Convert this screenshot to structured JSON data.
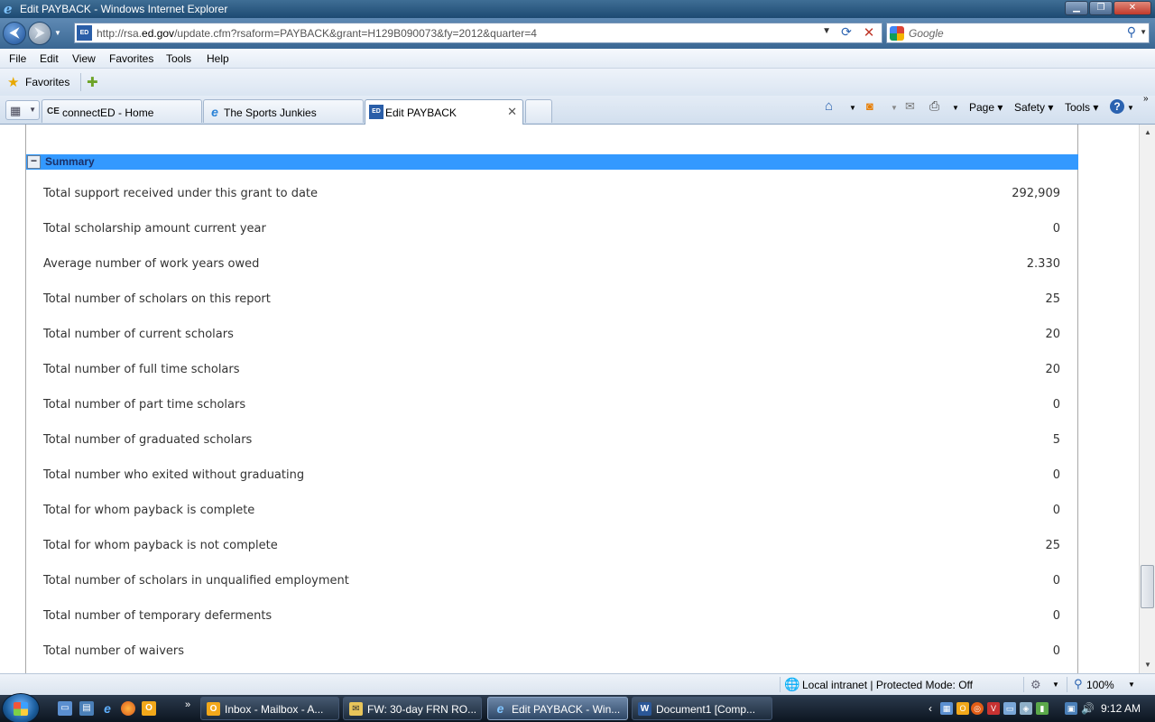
{
  "window": {
    "title": "Edit PAYBACK - Windows Internet Explorer"
  },
  "address_bar": {
    "url_prefix": "http://rsa.",
    "url_domain": "ed.gov",
    "url_suffix": "/update.cfm?rsaform=PAYBACK&grant=H129B090073&fy=2012&quarter=4",
    "page_icon_text": "ED"
  },
  "search": {
    "placeholder": "Google"
  },
  "menu": [
    "File",
    "Edit",
    "View",
    "Favorites",
    "Tools",
    "Help"
  ],
  "favorites_bar": {
    "label": "Favorites"
  },
  "tabs": [
    {
      "label": "connectED - Home",
      "icon": "connected-icon",
      "icon_text": "CE",
      "active": false
    },
    {
      "label": "The Sports Junkies",
      "icon": "ie-page-icon",
      "icon_text": "e",
      "active": false
    },
    {
      "label": "Edit PAYBACK",
      "icon": "ed-page-icon",
      "icon_text": "ED",
      "active": true
    }
  ],
  "ie_toolbar": {
    "page": "Page",
    "safety": "Safety",
    "tools": "Tools"
  },
  "summary": {
    "header": "Summary",
    "rows": [
      {
        "label": "Total support received under this grant to date",
        "value": "292,909"
      },
      {
        "label": "Total scholarship amount current year",
        "value": "0"
      },
      {
        "label": "Average number of work years owed",
        "value": "2.330"
      },
      {
        "label": "Total number of scholars on this report",
        "value": "25"
      },
      {
        "label": "Total number of current scholars",
        "value": "20"
      },
      {
        "label": "Total number of full time scholars",
        "value": "20"
      },
      {
        "label": "Total number of part time scholars",
        "value": "0"
      },
      {
        "label": "Total number of graduated scholars",
        "value": "5"
      },
      {
        "label": "Total number who exited without graduating",
        "value": "0"
      },
      {
        "label": "Total for whom payback is complete",
        "value": "0"
      },
      {
        "label": "Total for whom payback is not complete",
        "value": "25"
      },
      {
        "label": "Total number of scholars in unqualified employment",
        "value": "0"
      },
      {
        "label": "Total number of temporary deferments",
        "value": "0"
      },
      {
        "label": "Total number of waivers",
        "value": "0"
      }
    ]
  },
  "status_bar": {
    "zone": "Local intranet | Protected Mode: Off",
    "zoom": "100%"
  },
  "taskbar": {
    "buttons": [
      {
        "label": "Inbox - Mailbox - A...",
        "icon_text": "O",
        "active": false
      },
      {
        "label": "FW: 30-day FRN RO...",
        "icon_text": "✉",
        "active": false
      },
      {
        "label": "Edit PAYBACK - Win...",
        "icon_text": "e",
        "active": true
      },
      {
        "label": "Document1 [Comp...",
        "icon_text": "W",
        "active": false
      }
    ],
    "clock": "9:12 AM"
  },
  "colors": {
    "summary_header": "#3399ff",
    "summary_header_text": "#1a2f66",
    "titlebar": "#1d4a72"
  }
}
